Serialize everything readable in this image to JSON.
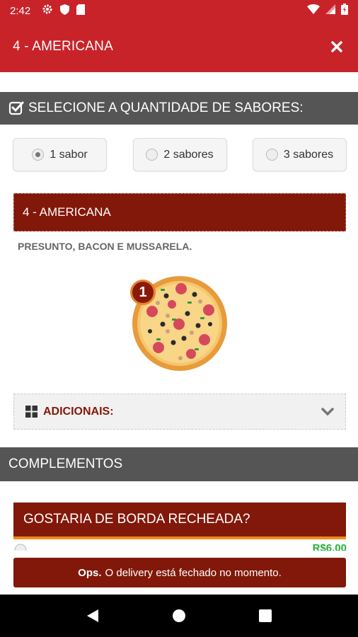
{
  "status_bar": {
    "time": "2:42"
  },
  "header": {
    "title": "4 - AMERICANA"
  },
  "sabores_section": {
    "title": "SELECIONE A QUANTIDADE DE SABORES:",
    "options": [
      {
        "label": "1 sabor",
        "selected": true
      },
      {
        "label": "2 sabores",
        "selected": false
      },
      {
        "label": "3 sabores",
        "selected": false
      }
    ]
  },
  "flavour": {
    "name": "4 - AMERICANA",
    "description": "PRESUNTO, BACON E MUSSARELA.",
    "badge": "1"
  },
  "adicionais": {
    "label": "ADICIONAIS:"
  },
  "complementos": {
    "title": "COMPLEMENTOS"
  },
  "borda": {
    "question": "GOSTARIA DE BORDA RECHEADA?",
    "price": "R$6,00"
  },
  "notice": {
    "bold": "Ops.",
    "text": "O delivery está fechado no momento."
  },
  "colors": {
    "brand_red": "#c9232a",
    "dark_red": "#821809",
    "accent_orange": "#f08a1a",
    "price_green": "#27ae3a"
  }
}
